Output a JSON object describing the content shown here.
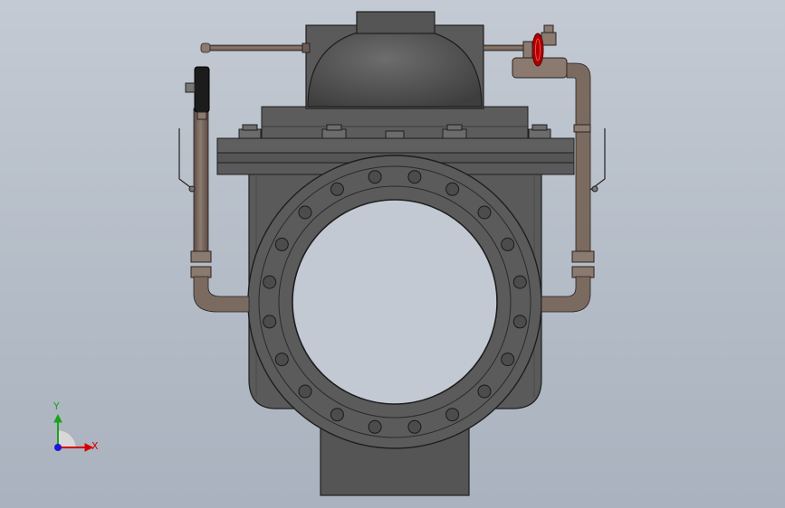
{
  "triad": {
    "x_label": "X",
    "y_label": "Y",
    "x_color": "#d40000",
    "y_color": "#1aa31a",
    "z_color": "#1a1ad4"
  },
  "colors": {
    "body": "#5d5d5d",
    "body_dark": "#3f3f3f",
    "pipe": "#7a6a60",
    "handwheel": "#b00000",
    "gauge": "#1c1c1c"
  },
  "icons": {
    "triad": "coordinate-triad-icon",
    "handwheel": "handwheel-icon",
    "gauge": "pressure-gauge-icon"
  }
}
